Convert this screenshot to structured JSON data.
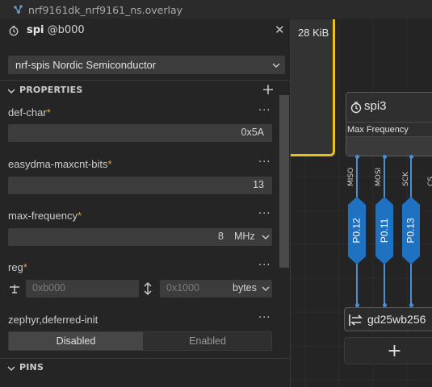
{
  "tab": {
    "title": "nrf9161dk_nrf9161_ns.overlay",
    "icon": "devicetree-icon"
  },
  "panel": {
    "node_name": "spi",
    "node_address": "@b000",
    "compatible": "nrf-spis  Nordic Semiconductor",
    "sections": {
      "properties": "PROPERTIES",
      "pins": "PINS"
    },
    "properties": {
      "def_char": {
        "label": "def-char",
        "required": "*",
        "value": "0x5A"
      },
      "easydma": {
        "label": "easydma-maxcnt-bits",
        "required": "*",
        "value": "13"
      },
      "max_frequency": {
        "label": "max-frequency",
        "required": "*",
        "value": "8",
        "unit": "MHz"
      },
      "reg": {
        "label": "reg",
        "required": "*",
        "address_placeholder": "0xb000",
        "size_placeholder": "0x1000",
        "unit": "bytes"
      },
      "zephyr_deferred": {
        "label": "zephyr,deferred-init",
        "options": [
          "Disabled",
          "Enabled"
        ],
        "selected": "Disabled"
      }
    },
    "menu_dots": "···"
  },
  "canvas": {
    "memory_label": "28 KiB",
    "spi_node": {
      "title": "spi3",
      "field_label": "Max Frequency"
    },
    "pin_names": [
      "MISO",
      "MOSI",
      "SCK",
      "CS"
    ],
    "pins": [
      "P0.12",
      "P0.11",
      "P0.13"
    ],
    "device": "gd25wb256",
    "add_label": "+"
  },
  "colors": {
    "accent_yellow": "#e8c21a",
    "pin_blue": "#1f72c2",
    "wire_blue": "#4a8fd6",
    "required": "#e5a24a"
  }
}
